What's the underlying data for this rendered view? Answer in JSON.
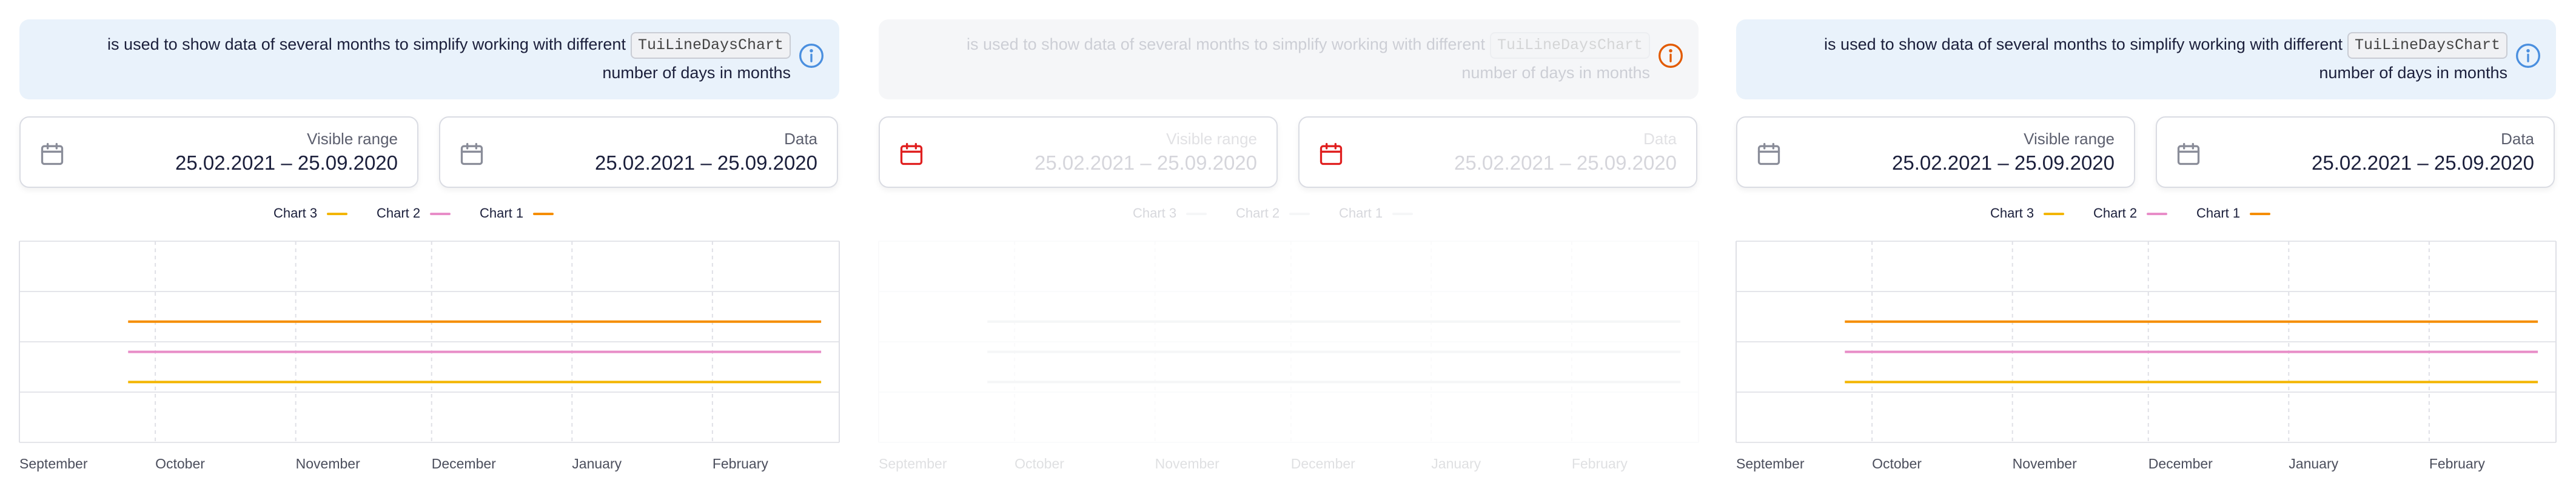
{
  "panels": [
    {
      "state": "normal",
      "notification": {
        "line1": "is used to show data of several months to simplify working with different",
        "code": "TuiLineDaysChart",
        "line2": "number of days in months",
        "icon": "info-icon",
        "icon_color": "#4a8fdf"
      },
      "fields": [
        {
          "label": "Visible range",
          "value": "25.02.2021 – 25.09.2020"
        },
        {
          "label": "Data",
          "value": "25.02.2021 – 25.09.2020"
        }
      ],
      "icon_color": "#8a8d99"
    },
    {
      "state": "disabled",
      "notification": {
        "line1": "is used to show data of several months to simplify working with different",
        "code": "TuiLineDaysChart",
        "line2": "number of days in months",
        "icon": "info-icon",
        "icon_color": "#e25a00"
      },
      "fields": [
        {
          "label": "Visible range",
          "value": "25.02.2021 – 25.09.2020"
        },
        {
          "label": "Data",
          "value": "25.02.2021 – 25.09.2020"
        }
      ],
      "icon_color": "#e01f1f"
    },
    {
      "state": "normal",
      "notification": {
        "line1": "is used to show data of several months to simplify working with different",
        "code": "TuiLineDaysChart",
        "line2": "number of days in months",
        "icon": "info-icon",
        "icon_color": "#4a8fdf"
      },
      "fields": [
        {
          "label": "Visible range",
          "value": "25.02.2021 – 25.09.2020"
        },
        {
          "label": "Data",
          "value": "25.02.2021 – 25.09.2020"
        }
      ],
      "icon_color": "#8a8d99"
    }
  ],
  "chart_data": {
    "type": "line",
    "x_labels": [
      "September",
      "October",
      "November",
      "December",
      "January",
      "February"
    ],
    "x_range": [
      "2020-09-01",
      "2021-03-01"
    ],
    "grid": true,
    "legend_position": "top-center",
    "series": [
      {
        "name": "Chart 3",
        "color": "#f3b500",
        "x_start": "2020-09-25",
        "x_end": "2021-02-25",
        "level": 0.3
      },
      {
        "name": "Chart 2",
        "color": "#e88dc8",
        "x_start": "2020-09-25",
        "x_end": "2021-02-25",
        "level": 0.45
      },
      {
        "name": "Chart 1",
        "color": "#f58d00",
        "x_start": "2020-09-25",
        "x_end": "2021-02-25",
        "level": 0.6
      }
    ],
    "disabled_series_color": "#c8cad2"
  }
}
